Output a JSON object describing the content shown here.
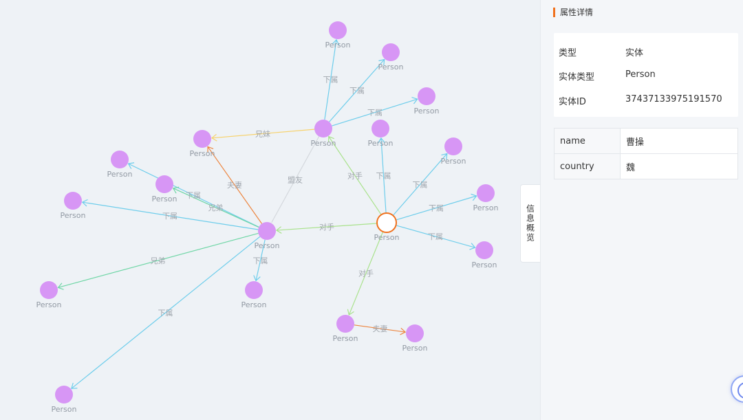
{
  "graph": {
    "colors": {
      "node_fill": "#d796f5",
      "selected_stroke": "#f0711d",
      "edge_subordinate": "#6dcdeb",
      "edge_sibling": "#6fd6a6",
      "edge_sister": "#f7d26b",
      "edge_spouse": "#ed8640",
      "edge_rival": "#a9e28c",
      "edge_ally": "#d4d8dd"
    },
    "nodes": [
      {
        "id": "n0",
        "label": "Person",
        "selected": true
      },
      {
        "id": "n1",
        "label": "Person"
      },
      {
        "id": "n2",
        "label": "Person"
      },
      {
        "id": "n3",
        "label": "Person"
      },
      {
        "id": "n4",
        "label": "Person"
      },
      {
        "id": "n5",
        "label": "Person"
      },
      {
        "id": "n6",
        "label": "Person"
      },
      {
        "id": "n7",
        "label": "Person"
      },
      {
        "id": "n8",
        "label": "Person"
      },
      {
        "id": "n9",
        "label": "Person"
      },
      {
        "id": "n10",
        "label": "Person"
      },
      {
        "id": "n11",
        "label": "Person"
      },
      {
        "id": "n12",
        "label": "Person"
      },
      {
        "id": "n13",
        "label": "Person"
      },
      {
        "id": "n14",
        "label": "Person"
      },
      {
        "id": "n15",
        "label": "Person"
      },
      {
        "id": "n16",
        "label": "Person"
      },
      {
        "id": "n17",
        "label": "Person"
      },
      {
        "id": "n18",
        "label": "Person"
      },
      {
        "id": "n19",
        "label": "Person"
      },
      {
        "id": "n20",
        "label": "Person"
      }
    ],
    "edges": [
      {
        "from": "n0",
        "to": "n1",
        "label": "下属",
        "type": "subordinate"
      },
      {
        "from": "n0",
        "to": "n2",
        "label": "下属",
        "type": "subordinate"
      },
      {
        "from": "n0",
        "to": "n3",
        "label": "下属",
        "type": "subordinate"
      },
      {
        "from": "n0",
        "to": "n4",
        "label": "下属",
        "type": "subordinate"
      },
      {
        "from": "n0",
        "to": "n5",
        "label": "对手",
        "type": "rival"
      },
      {
        "from": "n0",
        "to": "n6",
        "label": "对手",
        "type": "rival"
      },
      {
        "from": "n0",
        "to": "n8",
        "label": "对手",
        "type": "rival"
      },
      {
        "from": "n6",
        "to": "n7",
        "label": "夫妻",
        "type": "spouse"
      },
      {
        "from": "n5",
        "to": "n9",
        "label": "下属",
        "type": "subordinate"
      },
      {
        "from": "n5",
        "to": "n10",
        "label": "下属",
        "type": "subordinate"
      },
      {
        "from": "n5",
        "to": "n11",
        "label": "下属",
        "type": "subordinate"
      },
      {
        "from": "n5",
        "to": "n12",
        "label": "兄妹",
        "type": "sister"
      },
      {
        "from": "n5",
        "to": "n8",
        "label": "盟友",
        "type": "ally"
      },
      {
        "from": "n8",
        "to": "n12",
        "label": "夫妻",
        "type": "spouse"
      },
      {
        "from": "n8",
        "to": "n13",
        "label": "下属",
        "type": "subordinate"
      },
      {
        "from": "n8",
        "to": "n14",
        "label": "兄弟",
        "type": "sibling"
      },
      {
        "from": "n8",
        "to": "n15",
        "label": "下属",
        "type": "subordinate"
      },
      {
        "from": "n8",
        "to": "n16",
        "label": "兄弟",
        "type": "sibling"
      },
      {
        "from": "n8",
        "to": "n17",
        "label": "下属",
        "type": "subordinate"
      },
      {
        "from": "n8",
        "to": "n18",
        "label": "下属",
        "type": "subordinate"
      },
      {
        "from": "n14",
        "to": "n20",
        "label": "下属",
        "type": "subordinate"
      }
    ]
  },
  "overview_tab": {
    "label": "信息概览"
  },
  "panel": {
    "title": "属性详情",
    "info": [
      {
        "key": "类型",
        "value": "实体"
      },
      {
        "key": "实体类型",
        "value": "Person"
      },
      {
        "key": "实体ID",
        "value": "37437133975191570"
      }
    ],
    "attributes": [
      {
        "key": "name",
        "value": "曹操"
      },
      {
        "key": "country",
        "value": "魏"
      }
    ]
  }
}
